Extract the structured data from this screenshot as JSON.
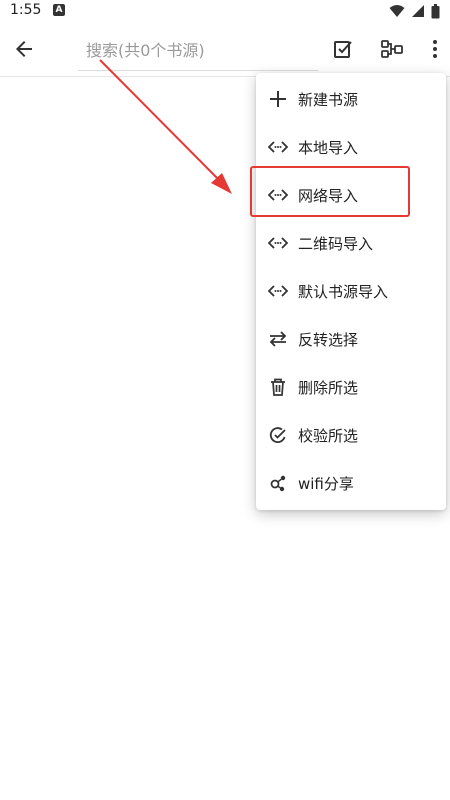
{
  "status_bar": {
    "time": "1:55",
    "notification_letter": "A"
  },
  "toolbar": {
    "search_placeholder": "搜索(共0个书源)"
  },
  "menu": {
    "items": [
      {
        "label": "新建书源",
        "icon": "plus-icon"
      },
      {
        "label": "本地导入",
        "icon": "import-icon"
      },
      {
        "label": "网络导入",
        "icon": "import-icon"
      },
      {
        "label": "二维码导入",
        "icon": "import-icon"
      },
      {
        "label": "默认书源导入",
        "icon": "import-icon"
      },
      {
        "label": "反转选择",
        "icon": "swap-icon"
      },
      {
        "label": "删除所选",
        "icon": "trash-icon"
      },
      {
        "label": "校验所选",
        "icon": "check-circle-icon"
      },
      {
        "label": "wifi分享",
        "icon": "share-icon"
      }
    ]
  },
  "colors": {
    "highlight": "#e53935",
    "arrow": "#e53935"
  }
}
